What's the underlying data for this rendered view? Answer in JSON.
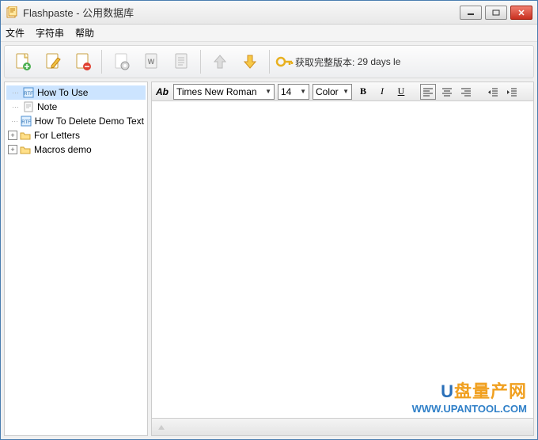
{
  "window": {
    "title": "Flashpaste - 公用数据库"
  },
  "menu": {
    "file": "文件",
    "strings": "字符串",
    "help": "帮助"
  },
  "toolbar": {
    "trial_text": "获取完整版本:",
    "trial_days": "29 days le"
  },
  "tree": {
    "items": [
      {
        "type": "rtf",
        "label": "How To Use",
        "selected": true
      },
      {
        "type": "txt",
        "label": "Note"
      },
      {
        "type": "rtf",
        "label": "How To Delete Demo Text"
      },
      {
        "type": "folder",
        "label": "For Letters",
        "expandable": true
      },
      {
        "type": "folder",
        "label": "Macros demo",
        "expandable": true
      }
    ]
  },
  "format": {
    "font": "Times New Roman",
    "size": "14",
    "color_label": "Color"
  },
  "watermark": {
    "line1_u": "U",
    "line1_rest": "盘量产网",
    "line2": "WWW.UPANTOOL.COM"
  }
}
